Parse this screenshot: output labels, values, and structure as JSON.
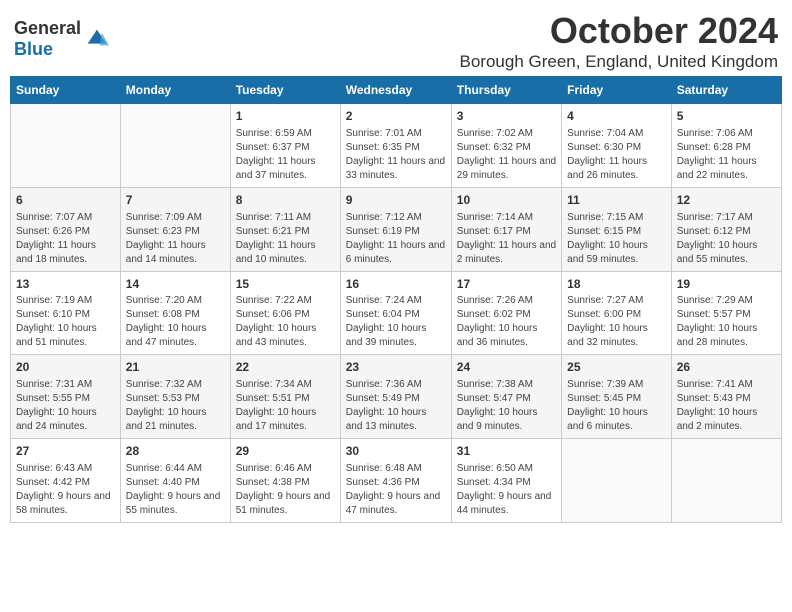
{
  "logo": {
    "general": "General",
    "blue": "Blue"
  },
  "title": "October 2024",
  "location": "Borough Green, England, United Kingdom",
  "days_of_week": [
    "Sunday",
    "Monday",
    "Tuesday",
    "Wednesday",
    "Thursday",
    "Friday",
    "Saturday"
  ],
  "weeks": [
    [
      {
        "day": "",
        "content": ""
      },
      {
        "day": "",
        "content": ""
      },
      {
        "day": "1",
        "content": "Sunrise: 6:59 AM\nSunset: 6:37 PM\nDaylight: 11 hours and 37 minutes."
      },
      {
        "day": "2",
        "content": "Sunrise: 7:01 AM\nSunset: 6:35 PM\nDaylight: 11 hours and 33 minutes."
      },
      {
        "day": "3",
        "content": "Sunrise: 7:02 AM\nSunset: 6:32 PM\nDaylight: 11 hours and 29 minutes."
      },
      {
        "day": "4",
        "content": "Sunrise: 7:04 AM\nSunset: 6:30 PM\nDaylight: 11 hours and 26 minutes."
      },
      {
        "day": "5",
        "content": "Sunrise: 7:06 AM\nSunset: 6:28 PM\nDaylight: 11 hours and 22 minutes."
      }
    ],
    [
      {
        "day": "6",
        "content": "Sunrise: 7:07 AM\nSunset: 6:26 PM\nDaylight: 11 hours and 18 minutes."
      },
      {
        "day": "7",
        "content": "Sunrise: 7:09 AM\nSunset: 6:23 PM\nDaylight: 11 hours and 14 minutes."
      },
      {
        "day": "8",
        "content": "Sunrise: 7:11 AM\nSunset: 6:21 PM\nDaylight: 11 hours and 10 minutes."
      },
      {
        "day": "9",
        "content": "Sunrise: 7:12 AM\nSunset: 6:19 PM\nDaylight: 11 hours and 6 minutes."
      },
      {
        "day": "10",
        "content": "Sunrise: 7:14 AM\nSunset: 6:17 PM\nDaylight: 11 hours and 2 minutes."
      },
      {
        "day": "11",
        "content": "Sunrise: 7:15 AM\nSunset: 6:15 PM\nDaylight: 10 hours and 59 minutes."
      },
      {
        "day": "12",
        "content": "Sunrise: 7:17 AM\nSunset: 6:12 PM\nDaylight: 10 hours and 55 minutes."
      }
    ],
    [
      {
        "day": "13",
        "content": "Sunrise: 7:19 AM\nSunset: 6:10 PM\nDaylight: 10 hours and 51 minutes."
      },
      {
        "day": "14",
        "content": "Sunrise: 7:20 AM\nSunset: 6:08 PM\nDaylight: 10 hours and 47 minutes."
      },
      {
        "day": "15",
        "content": "Sunrise: 7:22 AM\nSunset: 6:06 PM\nDaylight: 10 hours and 43 minutes."
      },
      {
        "day": "16",
        "content": "Sunrise: 7:24 AM\nSunset: 6:04 PM\nDaylight: 10 hours and 39 minutes."
      },
      {
        "day": "17",
        "content": "Sunrise: 7:26 AM\nSunset: 6:02 PM\nDaylight: 10 hours and 36 minutes."
      },
      {
        "day": "18",
        "content": "Sunrise: 7:27 AM\nSunset: 6:00 PM\nDaylight: 10 hours and 32 minutes."
      },
      {
        "day": "19",
        "content": "Sunrise: 7:29 AM\nSunset: 5:57 PM\nDaylight: 10 hours and 28 minutes."
      }
    ],
    [
      {
        "day": "20",
        "content": "Sunrise: 7:31 AM\nSunset: 5:55 PM\nDaylight: 10 hours and 24 minutes."
      },
      {
        "day": "21",
        "content": "Sunrise: 7:32 AM\nSunset: 5:53 PM\nDaylight: 10 hours and 21 minutes."
      },
      {
        "day": "22",
        "content": "Sunrise: 7:34 AM\nSunset: 5:51 PM\nDaylight: 10 hours and 17 minutes."
      },
      {
        "day": "23",
        "content": "Sunrise: 7:36 AM\nSunset: 5:49 PM\nDaylight: 10 hours and 13 minutes."
      },
      {
        "day": "24",
        "content": "Sunrise: 7:38 AM\nSunset: 5:47 PM\nDaylight: 10 hours and 9 minutes."
      },
      {
        "day": "25",
        "content": "Sunrise: 7:39 AM\nSunset: 5:45 PM\nDaylight: 10 hours and 6 minutes."
      },
      {
        "day": "26",
        "content": "Sunrise: 7:41 AM\nSunset: 5:43 PM\nDaylight: 10 hours and 2 minutes."
      }
    ],
    [
      {
        "day": "27",
        "content": "Sunrise: 6:43 AM\nSunset: 4:42 PM\nDaylight: 9 hours and 58 minutes."
      },
      {
        "day": "28",
        "content": "Sunrise: 6:44 AM\nSunset: 4:40 PM\nDaylight: 9 hours and 55 minutes."
      },
      {
        "day": "29",
        "content": "Sunrise: 6:46 AM\nSunset: 4:38 PM\nDaylight: 9 hours and 51 minutes."
      },
      {
        "day": "30",
        "content": "Sunrise: 6:48 AM\nSunset: 4:36 PM\nDaylight: 9 hours and 47 minutes."
      },
      {
        "day": "31",
        "content": "Sunrise: 6:50 AM\nSunset: 4:34 PM\nDaylight: 9 hours and 44 minutes."
      },
      {
        "day": "",
        "content": ""
      },
      {
        "day": "",
        "content": ""
      }
    ]
  ]
}
